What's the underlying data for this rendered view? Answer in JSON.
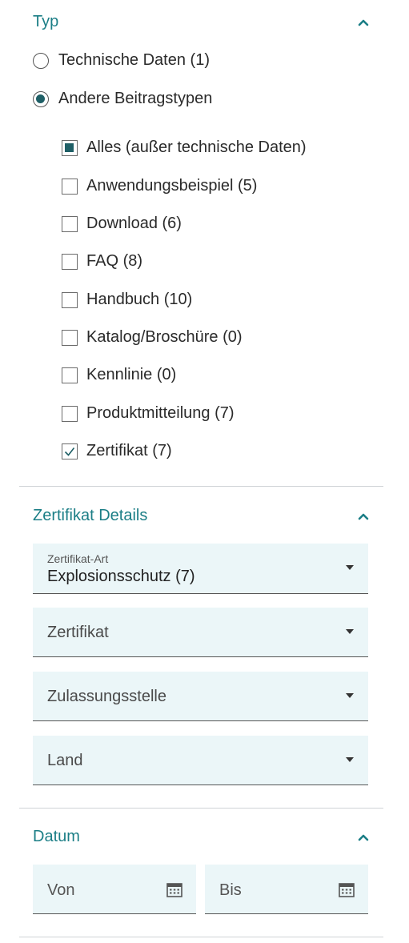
{
  "typ": {
    "title": "Typ",
    "radios": [
      {
        "label": "Technische Daten (1)",
        "selected": false
      },
      {
        "label": "Andere Beitragstypen",
        "selected": true
      }
    ],
    "checkboxes": [
      {
        "label": "Alles (außer technische Daten)",
        "state": "partial"
      },
      {
        "label": "Anwendungsbeispiel (5)",
        "state": "unchecked"
      },
      {
        "label": "Download (6)",
        "state": "unchecked"
      },
      {
        "label": "FAQ (8)",
        "state": "unchecked"
      },
      {
        "label": "Handbuch (10)",
        "state": "unchecked"
      },
      {
        "label": "Katalog/Broschüre (0)",
        "state": "unchecked"
      },
      {
        "label": "Kennlinie (0)",
        "state": "unchecked"
      },
      {
        "label": "Produktmitteilung (7)",
        "state": "unchecked"
      },
      {
        "label": "Zertifikat (7)",
        "state": "checked"
      }
    ]
  },
  "zertifikat_details": {
    "title": "Zertifikat Details",
    "zertifikat_art": {
      "label": "Zertifikat-Art",
      "value": "Explosionsschutz (7)"
    },
    "zertifikat": {
      "placeholder": "Zertifikat"
    },
    "zulassungsstelle": {
      "placeholder": "Zulassungsstelle"
    },
    "land": {
      "placeholder": "Land"
    }
  },
  "datum": {
    "title": "Datum",
    "von": {
      "placeholder": "Von"
    },
    "bis": {
      "placeholder": "Bis"
    }
  },
  "colors": {
    "accent": "#1b7e86",
    "field_bg": "#ebf6f8",
    "check_fill": "#1f5f66"
  },
  "icons": {
    "collapse": "chevron-up-icon",
    "dropdown": "caret-down-icon",
    "date": "calendar-icon"
  }
}
